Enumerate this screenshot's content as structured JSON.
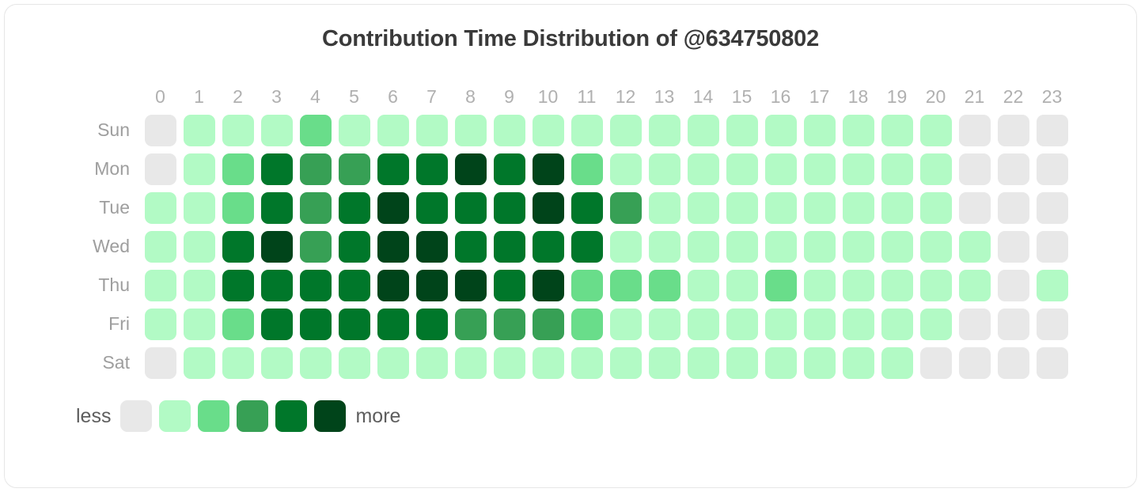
{
  "title": "Contribution Time Distribution of @634750802",
  "hours": [
    "0",
    "1",
    "2",
    "3",
    "4",
    "5",
    "6",
    "7",
    "8",
    "9",
    "10",
    "11",
    "12",
    "13",
    "14",
    "15",
    "16",
    "17",
    "18",
    "19",
    "20",
    "21",
    "22",
    "23"
  ],
  "days": [
    "Sun",
    "Mon",
    "Tue",
    "Wed",
    "Thu",
    "Fri",
    "Sat"
  ],
  "legend": {
    "less_label": "less",
    "more_label": "more"
  },
  "level_colors": [
    "#e8e8e8",
    "#b2fac5",
    "#69dd8a",
    "#37a055",
    "#00772a",
    "#00441a"
  ],
  "chart_data": {
    "type": "heatmap",
    "title": "Contribution Time Distribution of @634750802",
    "xlabel": "",
    "ylabel": "",
    "x": [
      "0",
      "1",
      "2",
      "3",
      "4",
      "5",
      "6",
      "7",
      "8",
      "9",
      "10",
      "11",
      "12",
      "13",
      "14",
      "15",
      "16",
      "17",
      "18",
      "19",
      "20",
      "21",
      "22",
      "23"
    ],
    "y": [
      "Sun",
      "Mon",
      "Tue",
      "Wed",
      "Thu",
      "Fri",
      "Sat"
    ],
    "value_scale": "0 = none (gray), 1-5 = increasing contribution intensity",
    "legend_position": "bottom-left",
    "grid": false,
    "values": [
      [
        0,
        1,
        1,
        1,
        2,
        1,
        1,
        1,
        1,
        1,
        1,
        1,
        1,
        1,
        1,
        1,
        1,
        1,
        1,
        1,
        1,
        0,
        0,
        0
      ],
      [
        0,
        1,
        2,
        4,
        3,
        3,
        4,
        4,
        5,
        4,
        5,
        2,
        1,
        1,
        1,
        1,
        1,
        1,
        1,
        1,
        1,
        0,
        0,
        0
      ],
      [
        1,
        1,
        2,
        4,
        3,
        4,
        5,
        4,
        4,
        4,
        5,
        4,
        3,
        1,
        1,
        1,
        1,
        1,
        1,
        1,
        1,
        0,
        0,
        0
      ],
      [
        1,
        1,
        4,
        5,
        3,
        4,
        5,
        5,
        4,
        4,
        4,
        4,
        1,
        1,
        1,
        1,
        1,
        1,
        1,
        1,
        1,
        1,
        0,
        0
      ],
      [
        1,
        1,
        4,
        4,
        4,
        4,
        5,
        5,
        5,
        4,
        5,
        2,
        2,
        2,
        1,
        1,
        2,
        1,
        1,
        1,
        1,
        1,
        0,
        1
      ],
      [
        1,
        1,
        2,
        4,
        4,
        4,
        4,
        4,
        3,
        3,
        3,
        2,
        1,
        1,
        1,
        1,
        1,
        1,
        1,
        1,
        1,
        0,
        0,
        0
      ],
      [
        0,
        1,
        1,
        1,
        1,
        1,
        1,
        1,
        1,
        1,
        1,
        1,
        1,
        1,
        1,
        1,
        1,
        1,
        1,
        1,
        0,
        0,
        0,
        0
      ]
    ]
  }
}
